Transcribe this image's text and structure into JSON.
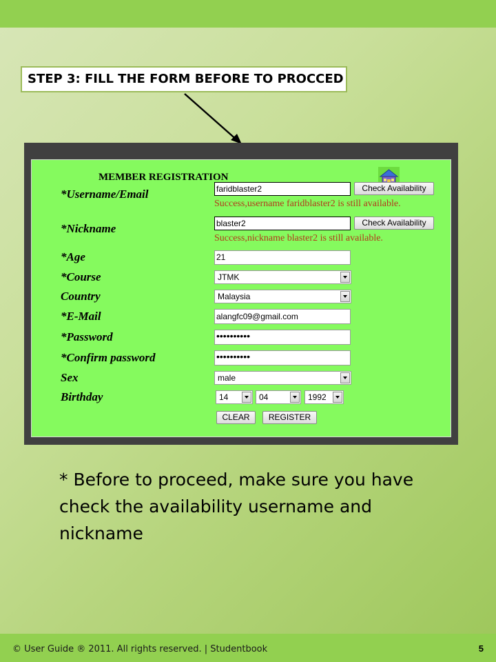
{
  "slide": {
    "callout": "STEP 3: FILL THE FORM BEFORE TO PROCCED",
    "note": "* Before to proceed, make sure you have check the availability username and nickname",
    "footer": "© User Guide ® 2011. All rights reserved. | Studentbook",
    "page_number": "5",
    "accent_color": "#92d050"
  },
  "form": {
    "title": "MEMBER REGISTRATION",
    "home_icon": "home-icon",
    "username": {
      "label": "*Username/Email",
      "value": "faridblaster2",
      "check_label": "Check Availability",
      "message": "Success,username faridblaster2 is still available."
    },
    "nickname": {
      "label": "*Nickname",
      "value": "blaster2",
      "check_label": "Check Availability",
      "message": "Success,nickname blaster2 is still available."
    },
    "age": {
      "label": "*Age",
      "value": "21"
    },
    "course": {
      "label": "*Course",
      "value": "JTMK"
    },
    "country": {
      "label": "Country",
      "value": "Malaysia"
    },
    "email": {
      "label": "*E-Mail",
      "value": "alangfc09@gmail.com"
    },
    "password": {
      "label": "*Password",
      "value": "••••••••••"
    },
    "confirm_password": {
      "label": "*Confirm password",
      "value": "••••••••••"
    },
    "sex": {
      "label": "Sex",
      "value": "male"
    },
    "birthday": {
      "label": "Birthday",
      "day": "14",
      "month": "04",
      "year": "1992"
    },
    "clear_label": "CLEAR",
    "register_label": "REGISTER"
  }
}
